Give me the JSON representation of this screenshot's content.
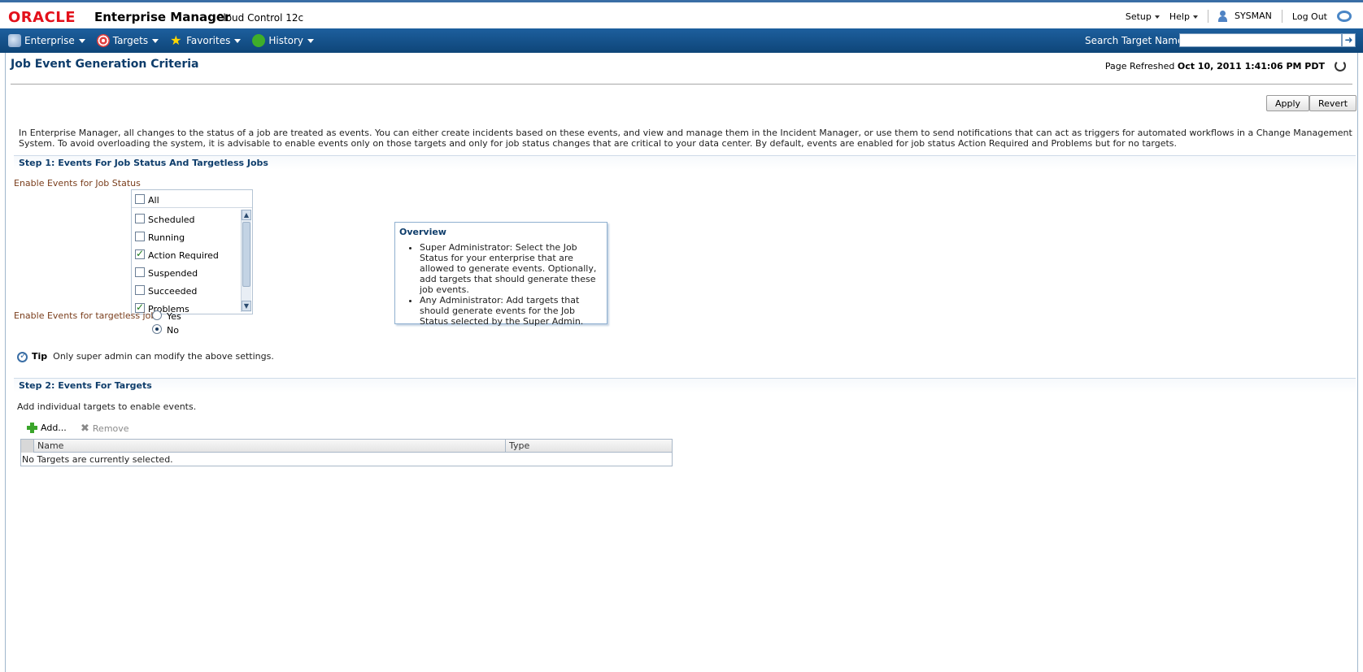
{
  "header": {
    "brand": "ORACLE",
    "product": "Enterprise Manager",
    "edition": "Cloud Control 12c",
    "links": {
      "setup": "Setup",
      "help": "Help",
      "user": "SYSMAN",
      "logout": "Log Out"
    }
  },
  "nav": {
    "items": [
      {
        "label": "Enterprise"
      },
      {
        "label": "Targets"
      },
      {
        "label": "Favorites"
      },
      {
        "label": "History"
      }
    ],
    "search_label": "Search Target Name",
    "search_value": ""
  },
  "page": {
    "title": "Job Event Generation Criteria",
    "refreshed_label": "Page Refreshed",
    "refreshed_time": "Oct 10, 2011 1:41:06 PM PDT",
    "apply": "Apply",
    "revert": "Revert",
    "intro": "In Enterprise Manager, all changes to the status of a job are treated as events. You can either create incidents based on these events, and view and manage them in the Incident Manager, or use them to send notifications that can act as triggers for automated workflows in a Change Management System. To avoid overloading the system, it is advisable to enable events only on those targets and only for job status changes that are critical to your data center. By default, events are enabled for job status Action Required and Problems but for no targets."
  },
  "step1": {
    "title": "Step 1: Events For Job Status And Targetless Jobs",
    "job_status_label": "Enable Events for Job Status",
    "all_label": "All",
    "statuses": [
      {
        "label": "Scheduled",
        "checked": false
      },
      {
        "label": "Running",
        "checked": false
      },
      {
        "label": "Action Required",
        "checked": true
      },
      {
        "label": "Suspended",
        "checked": false
      },
      {
        "label": "Succeeded",
        "checked": false
      },
      {
        "label": "Problems",
        "checked": true
      }
    ],
    "targetless_label": "Enable Events for targetless jobs",
    "yes": "Yes",
    "no": "No",
    "selected": "No"
  },
  "overview": {
    "title": "Overview",
    "items": [
      "Super Administrator: Select the Job Status for your enterprise that are allowed to generate events. Optionally, add targets that should generate these job events.",
      "Any Administrator: Add targets that should generate events for the Job Status selected by the Super Admin."
    ]
  },
  "tip": {
    "label": "Tip",
    "text": "Only super admin can modify the above settings."
  },
  "step2": {
    "title": "Step 2: Events For Targets",
    "desc": "Add individual targets to enable events.",
    "add": "Add...",
    "remove": "Remove",
    "columns": [
      "Name",
      "Type"
    ],
    "empty": "No Targets are currently selected."
  }
}
